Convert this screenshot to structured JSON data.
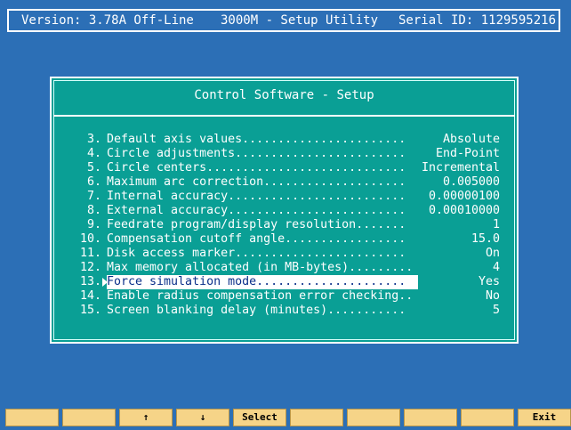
{
  "header": {
    "version": "Version: 3.78A Off-Line",
    "title": "3000M - Setup Utility",
    "serial": "Serial ID: 1129595216"
  },
  "dialog": {
    "title": "Control Software - Setup",
    "items": [
      {
        "num": "3.",
        "label": "Default axis values.......................",
        "value": "Absolute"
      },
      {
        "num": "4.",
        "label": "Circle adjustments........................",
        "value": "End-Point"
      },
      {
        "num": "5.",
        "label": "Circle centers............................",
        "value": "Incremental"
      },
      {
        "num": "6.",
        "label": "Maximum arc correction....................",
        "value": "0.005000"
      },
      {
        "num": "7.",
        "label": "Internal accuracy.........................",
        "value": "0.00000100"
      },
      {
        "num": "8.",
        "label": "External accuracy.........................",
        "value": "0.00010000"
      },
      {
        "num": "9.",
        "label": "Feedrate program/display resolution.......",
        "value": "1"
      },
      {
        "num": "10.",
        "label": "Compensation cutoff angle.................",
        "value": "15.0"
      },
      {
        "num": "11.",
        "label": "Disk access marker........................",
        "value": "On"
      },
      {
        "num": "12.",
        "label": "Max memory allocated (in MB-bytes).........",
        "value": "4"
      },
      {
        "num": "13.",
        "label": "Force simulation mode.....................",
        "value": "Yes"
      },
      {
        "num": "14.",
        "label": "Enable radius compensation error checking..",
        "value": "No"
      },
      {
        "num": "15.",
        "label": "Screen blanking delay (minutes)...........",
        "value": "5"
      }
    ],
    "selected_index": 10
  },
  "function_keys": [
    "",
    "",
    "↑",
    "↓",
    "Select",
    "",
    "",
    "",
    "",
    "Exit"
  ]
}
